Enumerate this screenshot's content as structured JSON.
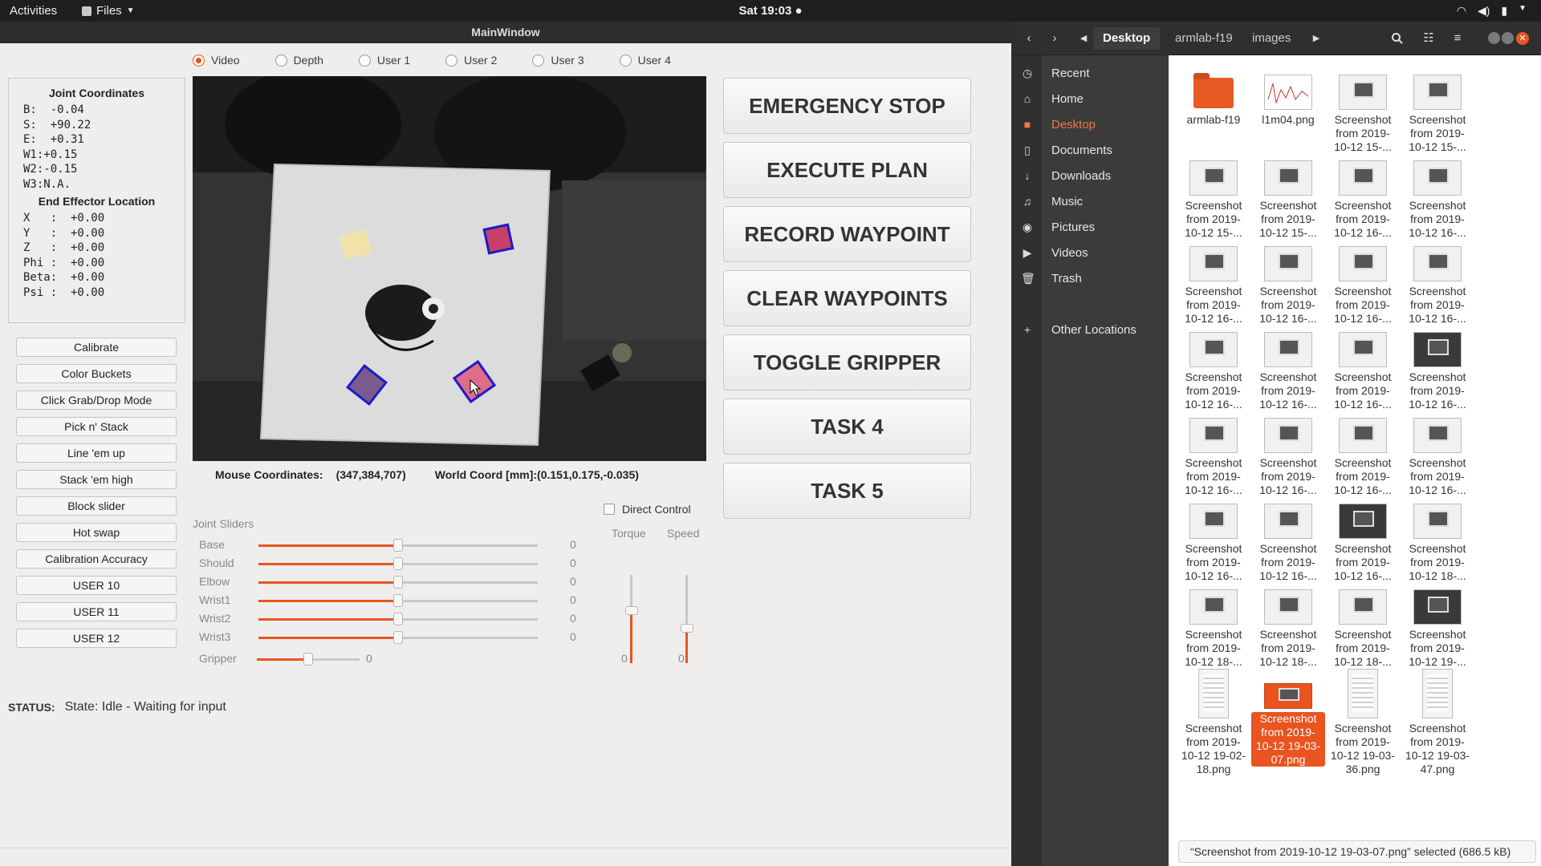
{
  "topbar": {
    "activities": "Activities",
    "app_menu": "Files",
    "clock": "Sat 19:03 ●"
  },
  "main": {
    "title": "MainWindow",
    "radios": [
      "Video",
      "Depth",
      "User 1",
      "User 2",
      "User 3",
      "User 4"
    ],
    "selected_radio": "Video",
    "joint_heading": "Joint Coordinates",
    "joints": [
      "B:  -0.04",
      "S:  +90.22",
      "E:  +0.31",
      "W1:+0.15",
      "W2:-0.15",
      "W3:N.A."
    ],
    "ee_heading": "End Effector Location",
    "ee": [
      "X   :  +0.00",
      "Y   :  +0.00",
      "Z   :  +0.00",
      "Phi :  +0.00",
      "Beta:  +0.00",
      "Psi :  +0.00"
    ],
    "left_buttons": [
      "Calibrate",
      "Color Buckets",
      "Click Grab/Drop Mode",
      "Pick n' Stack",
      "Line 'em up",
      "Stack 'em high",
      "Block slider",
      "Hot swap",
      "Calibration Accuracy",
      "USER 10",
      "USER 11",
      "USER 12"
    ],
    "mouse_label": "Mouse Coordinates:",
    "mouse_value": "(347,384,707)",
    "world_label": "World Coord [mm]:",
    "world_value": "(0.151,0.175,-0.035)",
    "big_buttons": [
      "EMERGENCY STOP",
      "EXECUTE PLAN",
      "RECORD WAYPOINT",
      "CLEAR WAYPOINTS",
      "TOGGLE GRIPPER",
      "TASK 4",
      "TASK 5"
    ],
    "sliders_heading": "Joint Sliders",
    "sliders": [
      {
        "label": "Base",
        "value": "0",
        "level": 0.5
      },
      {
        "label": "Should",
        "value": "0",
        "level": 0.5
      },
      {
        "label": "Elbow",
        "value": "0",
        "level": 0.5
      },
      {
        "label": "Wrist1",
        "value": "0",
        "level": 0.5
      },
      {
        "label": "Wrist2",
        "value": "0",
        "level": 0.5
      },
      {
        "label": "Wrist3",
        "value": "0",
        "level": 0.5
      }
    ],
    "gripper": {
      "label": "Gripper",
      "value": "0",
      "level": 0.5
    },
    "direct_control": "Direct Control",
    "torque_label": "Torque",
    "speed_label": "Speed",
    "torque_value": "0",
    "speed_value": "0",
    "torque_level": 0.6,
    "speed_level": 0.4,
    "status_label": "STATUS:",
    "status_text": "State: Idle - Waiting for input"
  },
  "files": {
    "breadcrumbs": [
      "Desktop",
      "armlab-f19",
      "images"
    ],
    "sidebar": [
      {
        "label": "Recent",
        "icon": "clock-icon",
        "glyph": "◷"
      },
      {
        "label": "Home",
        "icon": "home-icon",
        "glyph": "⌂"
      },
      {
        "label": "Desktop",
        "icon": "desktop-folder-icon",
        "glyph": "■"
      },
      {
        "label": "Documents",
        "icon": "document-icon",
        "glyph": "▯"
      },
      {
        "label": "Downloads",
        "icon": "download-icon",
        "glyph": "↓"
      },
      {
        "label": "Music",
        "icon": "music-icon",
        "glyph": "♫"
      },
      {
        "label": "Pictures",
        "icon": "camera-icon",
        "glyph": "◉"
      },
      {
        "label": "Videos",
        "icon": "video-icon",
        "glyph": "▶"
      },
      {
        "label": "Trash",
        "icon": "trash-icon",
        "glyph": "🗑"
      },
      {
        "label": "Other Locations",
        "icon": "plus-icon",
        "glyph": "+"
      }
    ],
    "active_sidebar": "Desktop",
    "items": [
      {
        "l1": "armlab-f19",
        "l2": "",
        "l3": "",
        "kind": "folder"
      },
      {
        "l1": "l1m04.png",
        "l2": "",
        "l3": "",
        "kind": "plot"
      },
      {
        "l1": "Screenshot",
        "l2": "from 2019-",
        "l3": "10-12 15-...",
        "kind": "shot"
      },
      {
        "l1": "Screenshot",
        "l2": "from 2019-",
        "l3": "10-12 15-...",
        "kind": "shot"
      },
      {
        "l1": "Screenshot",
        "l2": "from 2019-",
        "l3": "10-12 15-...",
        "kind": "shot"
      },
      {
        "l1": "Screenshot",
        "l2": "from 2019-",
        "l3": "10-12 15-...",
        "kind": "shot"
      },
      {
        "l1": "Screenshot",
        "l2": "from 2019-",
        "l3": "10-12 16-...",
        "kind": "shot"
      },
      {
        "l1": "Screenshot",
        "l2": "from 2019-",
        "l3": "10-12 16-...",
        "kind": "shot"
      },
      {
        "l1": "Screenshot",
        "l2": "from 2019-",
        "l3": "10-12 16-...",
        "kind": "shot"
      },
      {
        "l1": "Screenshot",
        "l2": "from 2019-",
        "l3": "10-12 16-...",
        "kind": "shot"
      },
      {
        "l1": "Screenshot",
        "l2": "from 2019-",
        "l3": "10-12 16-...",
        "kind": "shot"
      },
      {
        "l1": "Screenshot",
        "l2": "from 2019-",
        "l3": "10-12 16-...",
        "kind": "shot"
      },
      {
        "l1": "Screenshot",
        "l2": "from 2019-",
        "l3": "10-12 16-...",
        "kind": "shot"
      },
      {
        "l1": "Screenshot",
        "l2": "from 2019-",
        "l3": "10-12 16-...",
        "kind": "shot"
      },
      {
        "l1": "Screenshot",
        "l2": "from 2019-",
        "l3": "10-12 16-...",
        "kind": "shot"
      },
      {
        "l1": "Screenshot",
        "l2": "from 2019-",
        "l3": "10-12 16-...",
        "kind": "dark"
      },
      {
        "l1": "Screenshot",
        "l2": "from 2019-",
        "l3": "10-12 16-...",
        "kind": "shot"
      },
      {
        "l1": "Screenshot",
        "l2": "from 2019-",
        "l3": "10-12 16-...",
        "kind": "shot"
      },
      {
        "l1": "Screenshot",
        "l2": "from 2019-",
        "l3": "10-12 16-...",
        "kind": "shot"
      },
      {
        "l1": "Screenshot",
        "l2": "from 2019-",
        "l3": "10-12 16-...",
        "kind": "shot"
      },
      {
        "l1": "Screenshot",
        "l2": "from 2019-",
        "l3": "10-12 16-...",
        "kind": "shot"
      },
      {
        "l1": "Screenshot",
        "l2": "from 2019-",
        "l3": "10-12 16-...",
        "kind": "shot"
      },
      {
        "l1": "Screenshot",
        "l2": "from 2019-",
        "l3": "10-12 16-...",
        "kind": "dark"
      },
      {
        "l1": "Screenshot",
        "l2": "from 2019-",
        "l3": "10-12 18-...",
        "kind": "shot"
      },
      {
        "l1": "Screenshot",
        "l2": "from 2019-",
        "l3": "10-12 18-...",
        "kind": "shot"
      },
      {
        "l1": "Screenshot",
        "l2": "from 2019-",
        "l3": "10-12 18-...",
        "kind": "shot"
      },
      {
        "l1": "Screenshot",
        "l2": "from 2019-",
        "l3": "10-12 18-...",
        "kind": "shot"
      },
      {
        "l1": "Screenshot",
        "l2": "from 2019-",
        "l3": "10-12 19-...",
        "kind": "dark"
      },
      {
        "l1": "Screenshot",
        "l2": "from 2019-",
        "l3": "10-12 19-02-",
        "l4": "18.png",
        "kind": "tall"
      },
      {
        "l1": "Screenshot",
        "l2": "from 2019-",
        "l3": "10-12 19-03-",
        "l4": "07.png",
        "kind": "sel"
      },
      {
        "l1": "Screenshot",
        "l2": "from 2019-",
        "l3": "10-12 19-03-",
        "l4": "36.png",
        "kind": "tall"
      },
      {
        "l1": "Screenshot",
        "l2": "from 2019-",
        "l3": "10-12 19-03-",
        "l4": "47.png",
        "kind": "tall"
      }
    ],
    "status": "“Screenshot from 2019-10-12 19-03-07.png” selected  (686.5 kB)"
  }
}
